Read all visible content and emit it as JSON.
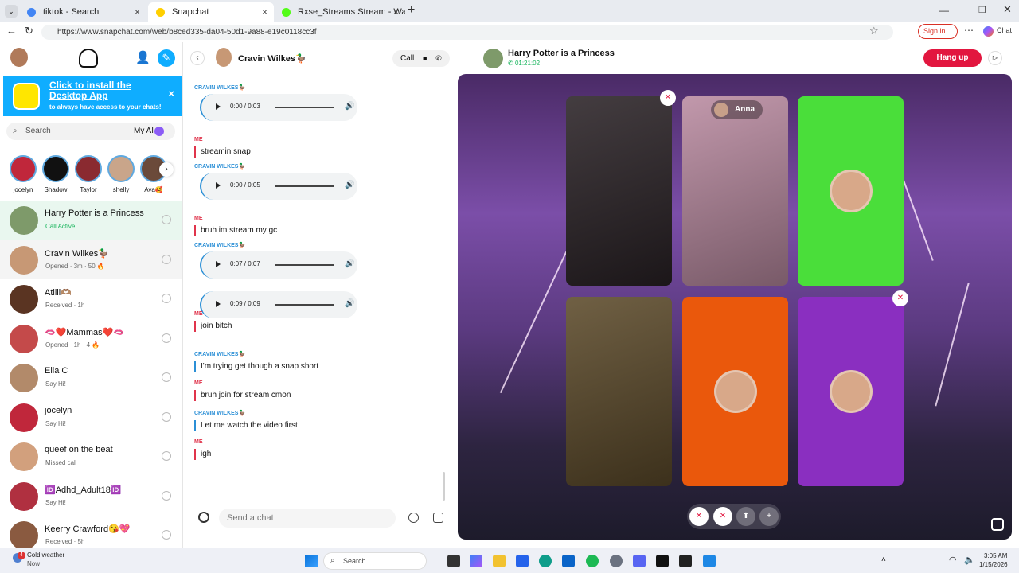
{
  "browser": {
    "tabs": [
      {
        "title": "tiktok - Search",
        "favicon_color": "#4285f4",
        "active": false
      },
      {
        "title": "Snapchat",
        "favicon_color": "#ffcf00",
        "active": true
      },
      {
        "title": "Rxse_Streams Stream - Watch Live",
        "favicon_color": "#53fc18",
        "active": false
      }
    ],
    "new_tab": "+",
    "url": "https://www.snapchat.com/web/b8ced335-da04-50d1-9a88-e19c0118cc3f",
    "sign_in": "Sign in",
    "chat": "Chat"
  },
  "promo": {
    "title": "Click to install the Desktop App",
    "subtitle": "to always have access to your chats!",
    "close": "×"
  },
  "search": {
    "placeholder": "Search",
    "my_ai": "My AI"
  },
  "stories": [
    {
      "name": "jocelyn",
      "color": "#c0273b"
    },
    {
      "name": "Shadow",
      "color": "#111111"
    },
    {
      "name": "Taylor",
      "color": "#8a2a30"
    },
    {
      "name": "shelly",
      "color": "#c9a58a"
    },
    {
      "name": "Ava🥰",
      "color": "#6b4a3a"
    }
  ],
  "conversations": [
    {
      "name": "Harry Potter is a Princess",
      "status": "Call Active",
      "status_color": "#16b45b",
      "avatar_color": "#7e9a6a"
    },
    {
      "name": "Cravin Wilkes🦆",
      "status": "Opened · 3m · 50 🔥",
      "status_color": "#666666",
      "avatar_color": "#c79875"
    },
    {
      "name": "Atiiii🫶🏽",
      "status": "Received · 1h",
      "status_color": "#666666",
      "avatar_color": "#5a3422"
    },
    {
      "name": "🫦❤️Mammas❤️🫦",
      "status": "Opened · 1h · 4 🔥",
      "status_color": "#666666",
      "avatar_color": "#c44a4a"
    },
    {
      "name": "Ella C",
      "status": "Say Hi!",
      "status_color": "#666666",
      "avatar_color": "#b28a6a"
    },
    {
      "name": "jocelyn",
      "status": "Say Hi!",
      "status_color": "#666666",
      "avatar_color": "#c0273b"
    },
    {
      "name": "queef on the beat",
      "status": "Missed call",
      "status_color": "#666666",
      "avatar_color": "#d2a07d"
    },
    {
      "name": "🆔Adhd_Adult18🆔",
      "status": "Say Hi!",
      "status_color": "#666666",
      "avatar_color": "#b03040"
    },
    {
      "name": "Keerry Crawford😘💖",
      "status": "Received · 5h",
      "status_color": "#666666",
      "avatar_color": "#8a5a40"
    }
  ],
  "chat": {
    "contact": "Cravin Wilkes🦆",
    "call_label": "Call",
    "messages": [
      {
        "kind": "audio",
        "sender": "CRAVIN WILKES🦆",
        "time": "0:00 / 0:03",
        "sender_color": "#2b8fd6"
      },
      {
        "kind": "text",
        "sender": "ME",
        "text": "streamin snap",
        "sender_color": "#e0344b"
      },
      {
        "kind": "audio",
        "sender": "CRAVIN WILKES🦆",
        "time": "0:00 / 0:05",
        "sender_color": "#2b8fd6"
      },
      {
        "kind": "text",
        "sender": "ME",
        "text": "bruh im stream my gc",
        "sender_color": "#e0344b"
      },
      {
        "kind": "audio",
        "sender": "CRAVIN WILKES🦆",
        "time": "0:07 / 0:07",
        "sender_color": "#2b8fd6"
      },
      {
        "kind": "audio",
        "sender": "",
        "time": "0:09 / 0:09",
        "sender_color": "#2b8fd6"
      },
      {
        "kind": "text",
        "sender": "ME",
        "text": "join bitch",
        "sender_color": "#e0344b"
      },
      {
        "kind": "text",
        "sender": "CRAVIN WILKES🦆",
        "text": "I'm trying get though a snap short",
        "sender_color": "#2b8fd6"
      },
      {
        "kind": "text",
        "sender": "ME",
        "text": "bruh join for stream cmon",
        "sender_color": "#e0344b"
      },
      {
        "kind": "text",
        "sender": "CRAVIN WILKES🦆",
        "text": "Let me watch the video first",
        "sender_color": "#2b8fd6"
      },
      {
        "kind": "text",
        "sender": "ME",
        "text": "igh",
        "sender_color": "#e0344b"
      }
    ],
    "compose_placeholder": "Send a chat"
  },
  "call": {
    "group_name": "Harry Potter is a Princess",
    "timer": "01:21:02",
    "hang_up": "Hang up",
    "participant_label": "Anna",
    "tiles": [
      {
        "type": "video",
        "color": "#2a2226"
      },
      {
        "type": "video",
        "color": "#b98aa0"
      },
      {
        "type": "avatar",
        "color": "#4ade3a"
      },
      {
        "type": "video",
        "color": "#5c4a2a"
      },
      {
        "type": "avatar",
        "color": "#ea580c"
      },
      {
        "type": "avatar",
        "color": "#8a2fc0"
      }
    ]
  },
  "taskbar": {
    "weather_title": "Cold weather",
    "weather_sub": "Now",
    "weather_badge": "4",
    "search": "Search",
    "time": "3:05 AM",
    "date": "1/15/2026"
  },
  "colors": {
    "snap_blue": "#0fadff",
    "hangup_red": "#e2163f",
    "me_red": "#e0344b",
    "friend_blue": "#2b8fd6"
  }
}
